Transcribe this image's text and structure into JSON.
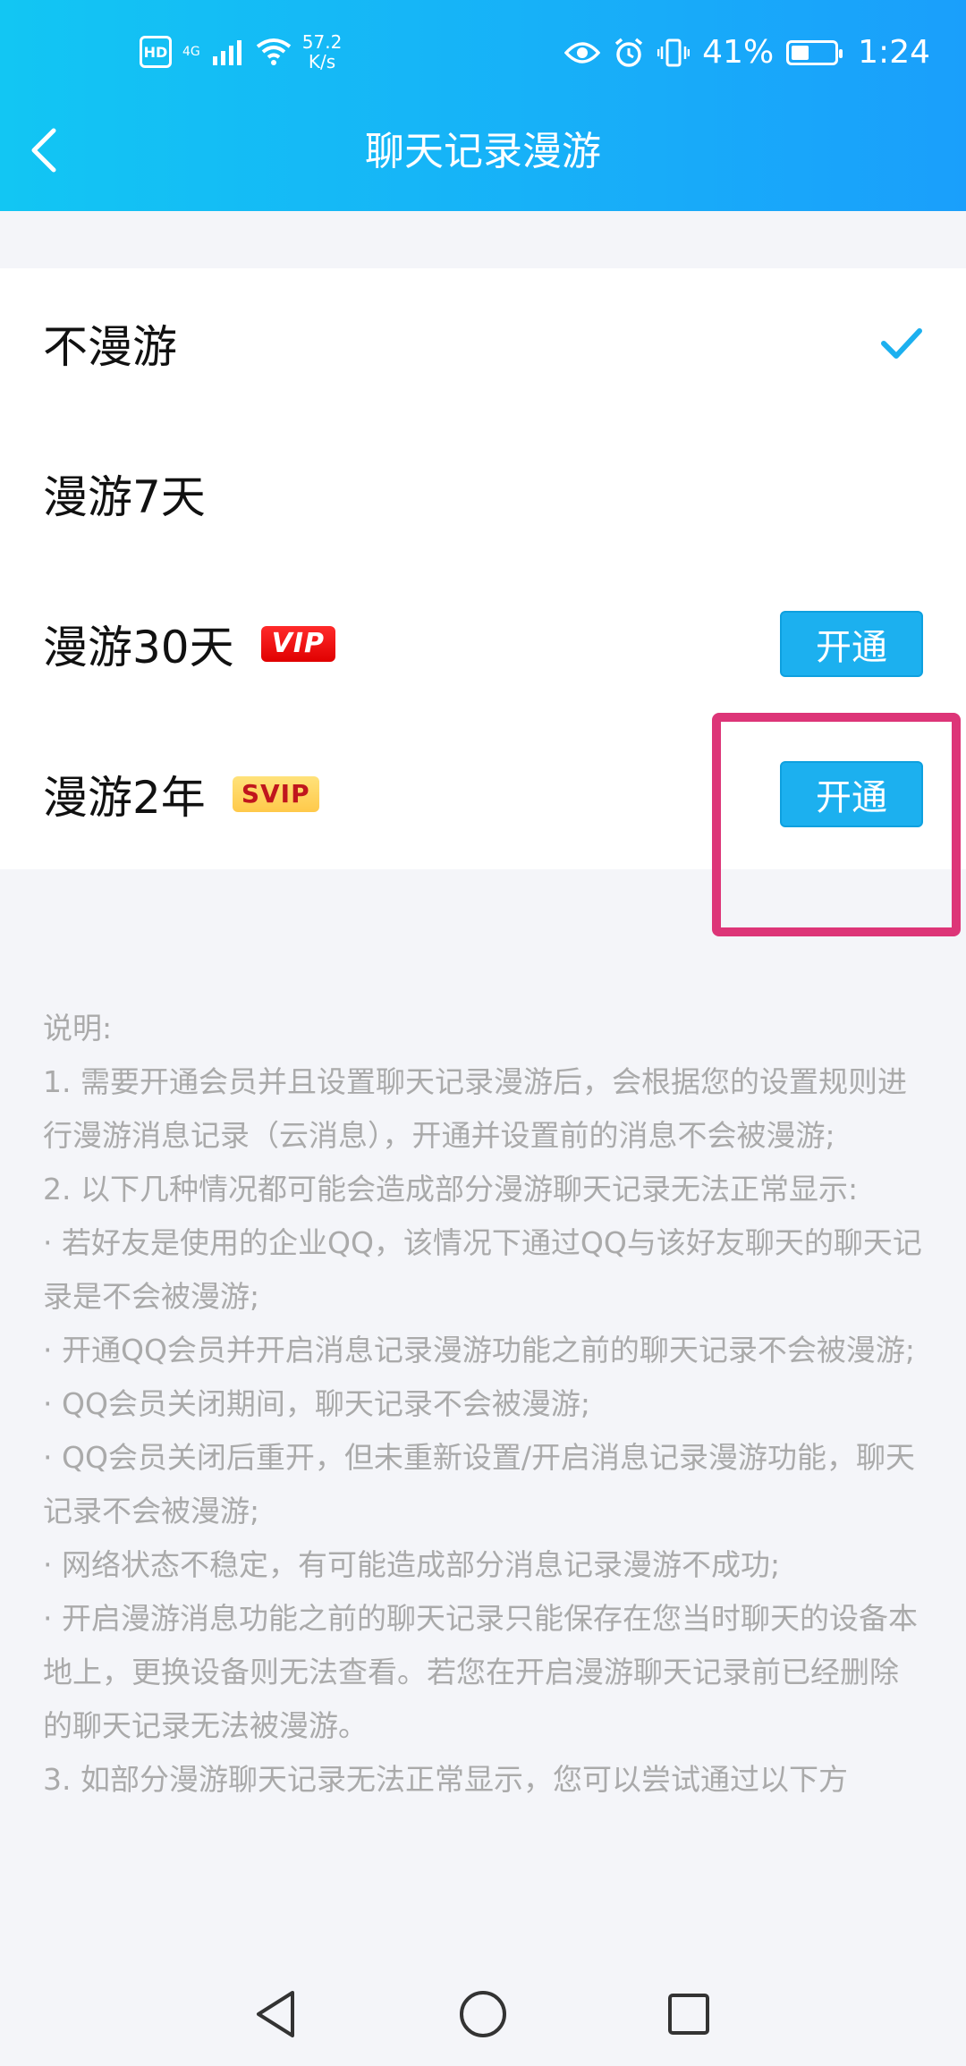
{
  "status_bar": {
    "hd_label": "HD",
    "network_label": "4G",
    "speed_value": "57.2",
    "speed_unit": "K/s",
    "battery_percent": "41%",
    "battery_level": 0.41,
    "time": "1:24"
  },
  "header": {
    "title": "聊天记录漫游"
  },
  "options": [
    {
      "label": "不漫游",
      "selected": true
    },
    {
      "label": "漫游7天",
      "selected": false
    },
    {
      "label": "漫游30天",
      "badge": "VIP",
      "button": "开通",
      "selected": false
    },
    {
      "label": "漫游2年",
      "badge": "SVIP",
      "button": "开通",
      "selected": false
    }
  ],
  "notes": [
    "说明:",
    "1. 需要开通会员并且设置聊天记录漫游后，会根据您的设置规则进行漫游消息记录（云消息），开通并设置前的消息不会被漫游;",
    "2. 以下几种情况都可能会造成部分漫游聊天记录无法正常显示:",
    "· 若好友是使用的企业QQ，该情况下通过QQ与该好友聊天的聊天记录是不会被漫游;",
    "· 开通QQ会员并开启消息记录漫游功能之前的聊天记录不会被漫游;",
    "· QQ会员关闭期间，聊天记录不会被漫游;",
    "· QQ会员关闭后重开，但未重新设置/开启消息记录漫游功能，聊天记录不会被漫游;",
    "· 网络状态不稳定，有可能造成部分消息记录漫游不成功;",
    "· 开启漫游消息功能之前的聊天记录只能保存在您当时聊天的设备本地上，更换设备则无法查看。若您在开启漫游聊天记录前已经删除的聊天记录无法被漫游。",
    "3. 如部分漫游聊天记录无法正常显示，您可以尝试通过以下方"
  ],
  "colors": {
    "header_start": "#12c6f3",
    "header_end": "#1a9ffb",
    "accent": "#1cb0ef",
    "highlight": "#dd3578",
    "notes_text": "#aaaaaa"
  }
}
